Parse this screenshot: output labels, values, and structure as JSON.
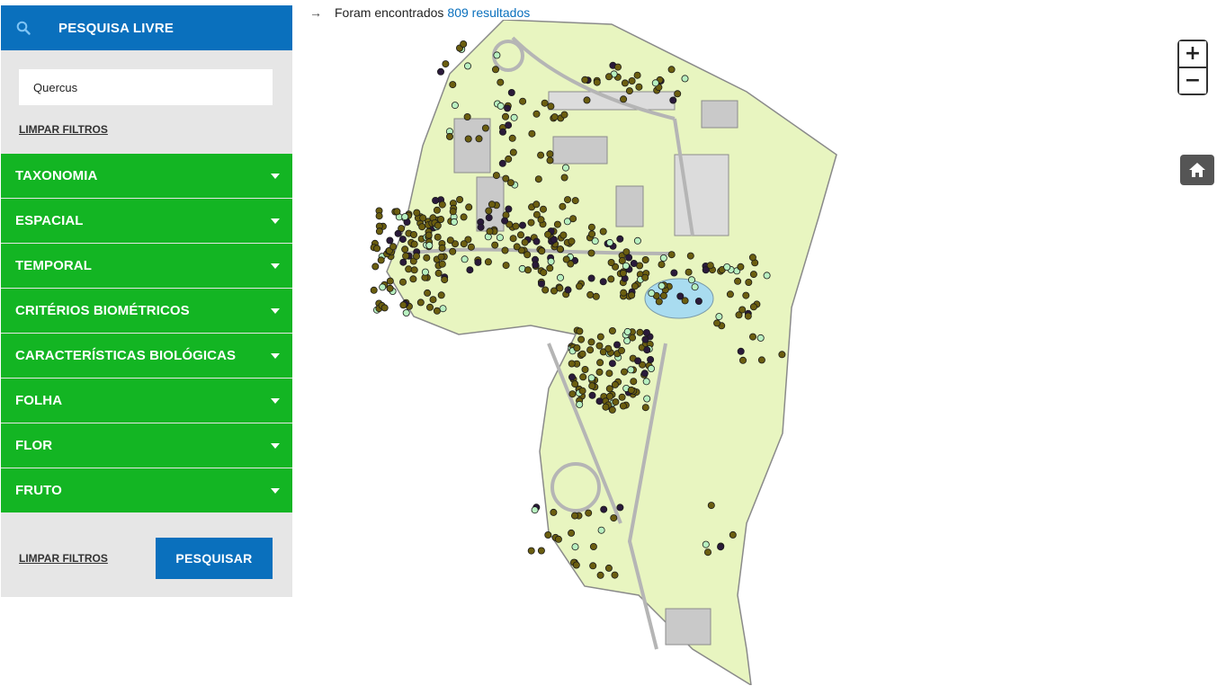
{
  "search": {
    "header_title": "PESQUISA LIVRE",
    "query_value": "Quercus",
    "clear_label": "LIMPAR FILTROS"
  },
  "filters": [
    {
      "label": "TAXONOMIA"
    },
    {
      "label": "ESPACIAL"
    },
    {
      "label": "TEMPORAL"
    },
    {
      "label": "CRITÉRIOS BIOMÉTRICOS"
    },
    {
      "label": "CARACTERÍSTICAS BIOLÓGICAS"
    },
    {
      "label": "FOLHA"
    },
    {
      "label": "FLOR"
    },
    {
      "label": "FRUTO"
    }
  ],
  "footer": {
    "clear_label": "LIMPAR FILTROS",
    "search_label": "PESQUISAR"
  },
  "results": {
    "prefix": "Foram encontrados",
    "count_text": "809 resultados"
  },
  "map_controls": {
    "zoom_in": "+",
    "zoom_out": "−"
  },
  "colors": {
    "primary_blue": "#0a70bd",
    "filter_green": "#13b523",
    "map_land": "#e8f5c0",
    "marker_olive": "#6b5e10",
    "marker_dark": "#2a1a3a",
    "marker_light": "#b8f0c0"
  }
}
